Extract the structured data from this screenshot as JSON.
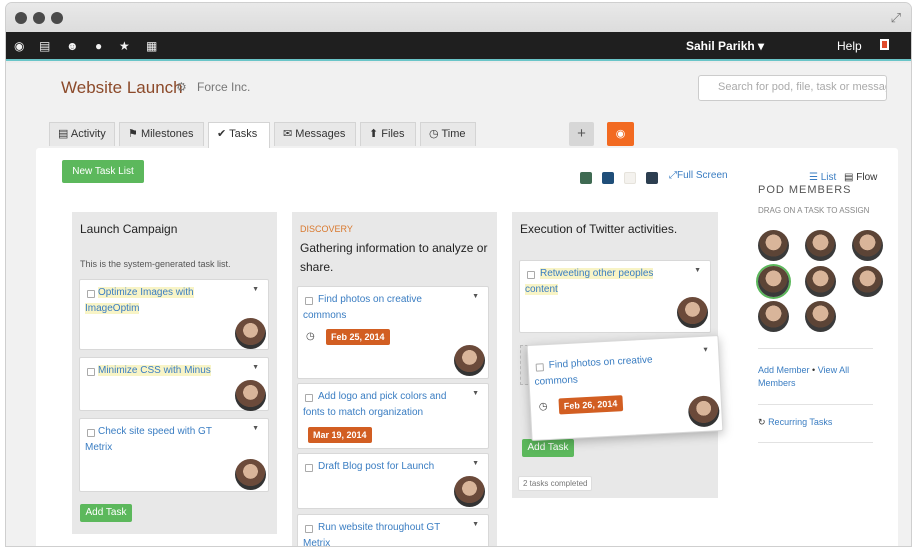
{
  "nav": {
    "user_name": "Sahil Parikh",
    "user_caret": "▾",
    "help": "Help"
  },
  "page": {
    "title": "Website Launch",
    "company": "Force Inc.",
    "search_placeholder": "Search for pod, file, task or message"
  },
  "tabs": [
    {
      "label": "Activity",
      "icon": "film-icon"
    },
    {
      "label": "Milestones",
      "icon": "flag-icon"
    },
    {
      "label": "Tasks",
      "icon": "check-icon",
      "active": true
    },
    {
      "label": "Messages",
      "icon": "envelope-icon"
    },
    {
      "label": "Files",
      "icon": "upload-icon"
    },
    {
      "label": "Time",
      "icon": "clock-icon"
    }
  ],
  "plus": "+",
  "toolbar": {
    "new_task_list": "New Task List",
    "full_screen": "Full Screen",
    "view_list": "List",
    "view_flow": "Flow",
    "swatches": [
      "#3f6a52",
      "#1f4e79",
      "#f4f2ee",
      "#2c3e50"
    ]
  },
  "lists": [
    {
      "title": "Launch Campaign",
      "note": "This is the system-generated task list.",
      "tasks": [
        {
          "text": "Optimize Images with ImageOptim"
        },
        {
          "text": "Minimize CSS with Minus"
        },
        {
          "text": "Check site speed with GT Metrix"
        }
      ],
      "add_task": "Add Task"
    },
    {
      "category": "DISCOVERY",
      "title": "Gathering information to analyze or share.",
      "tasks": [
        {
          "text": "Find photos on creative commons",
          "date": "Feb 25, 2014"
        },
        {
          "text": "Add logo and pick colors and fonts to match organization",
          "date": "Mar 19, 2014"
        },
        {
          "text": "Draft Blog post for Launch"
        },
        {
          "text": "Run website throughout GT Metrix"
        }
      ]
    },
    {
      "title": "Execution of Twitter activities.",
      "tasks": [
        {
          "text": "Retweeting other peoples content"
        }
      ],
      "dragging": {
        "text": "Find photos on creative commons",
        "date": "Feb 26, 2014"
      },
      "add_task": "Add Task",
      "completed": "2 tasks completed"
    }
  ],
  "pod": {
    "heading": "POD MEMBERS",
    "subheading": "DRAG ON A TASK TO ASSIGN",
    "add_member": "Add Member",
    "view_all": "View All Members",
    "bullet": "•",
    "recurring": "Recurring Tasks"
  }
}
